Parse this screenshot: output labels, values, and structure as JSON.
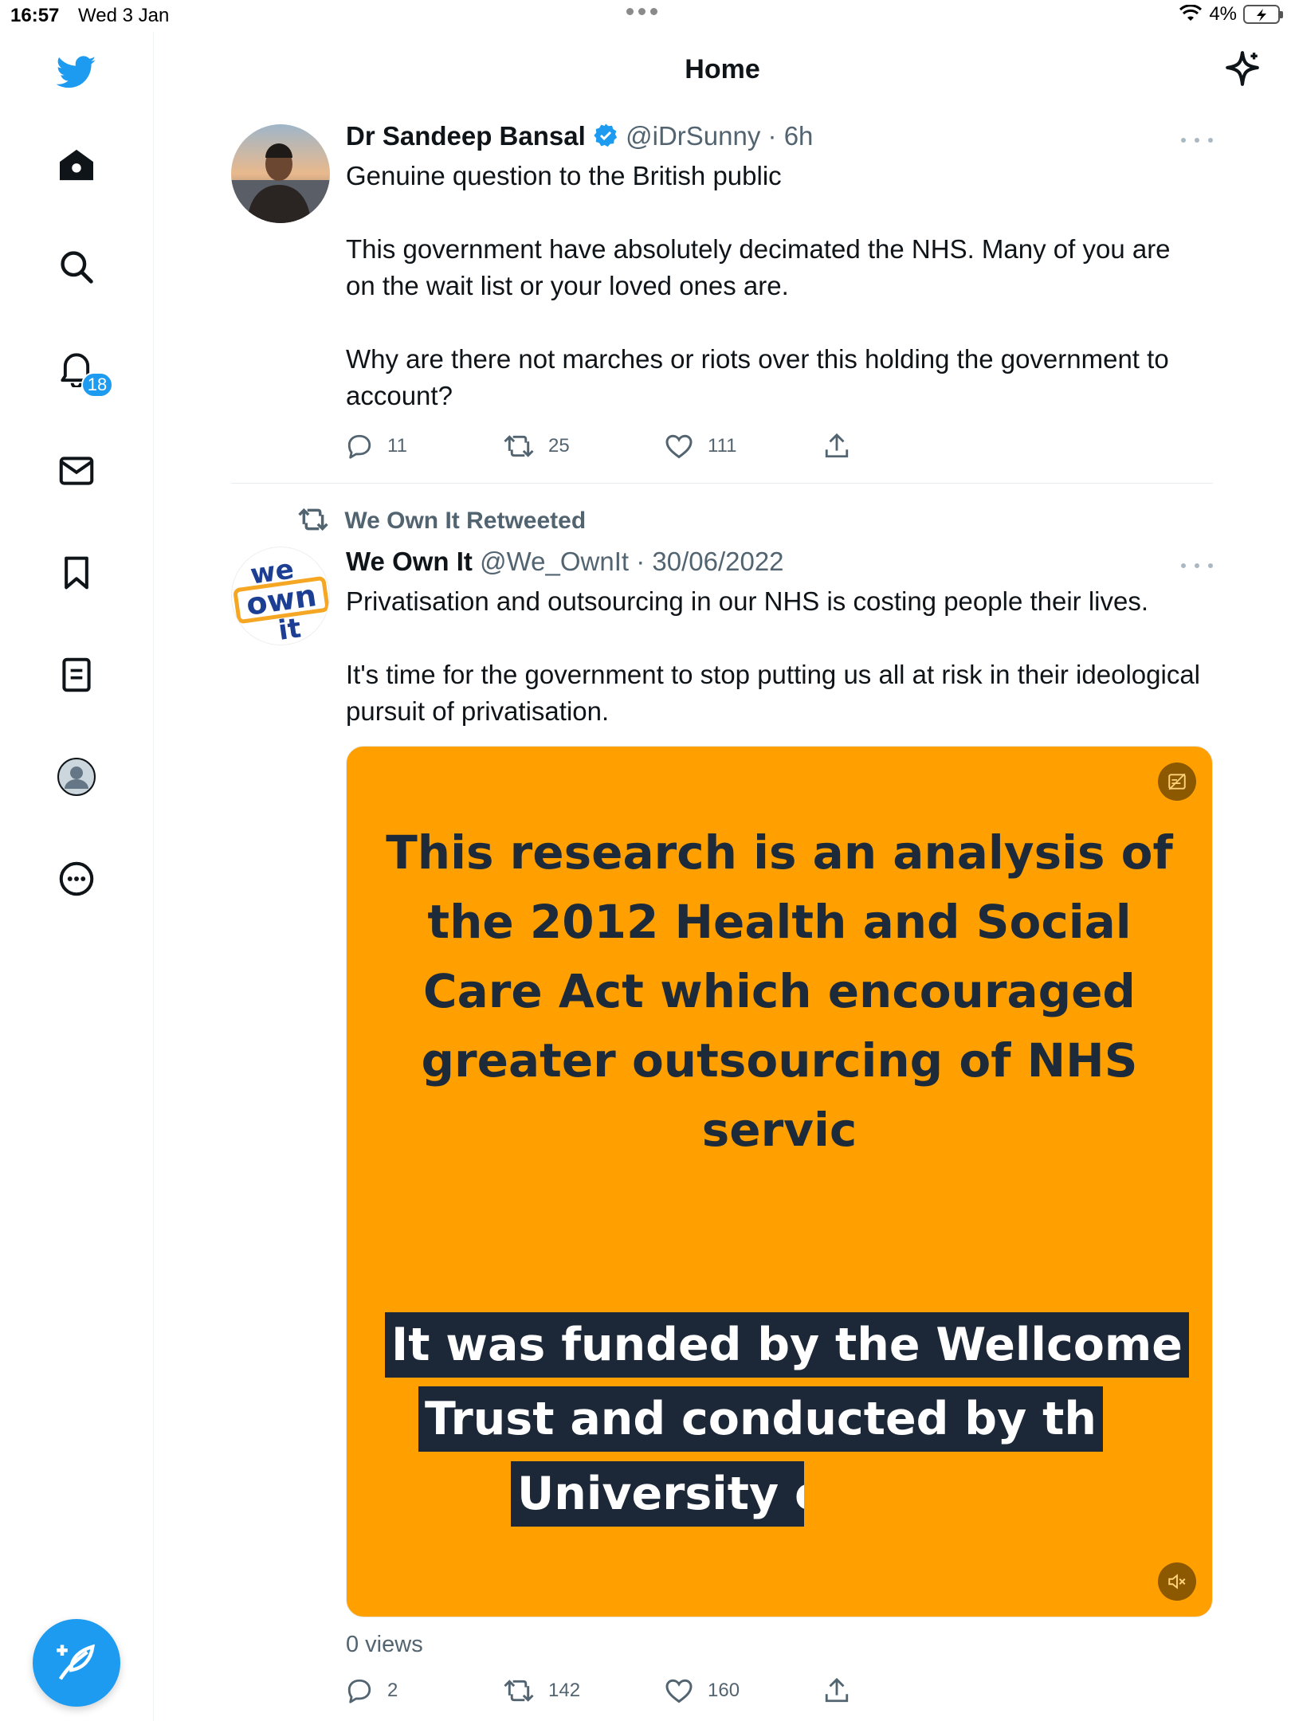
{
  "status_bar": {
    "time": "16:57",
    "date": "Wed 3 Jan",
    "battery": "4%"
  },
  "header": {
    "title": "Home"
  },
  "sidebar": {
    "notifications_badge": "18"
  },
  "tweets": [
    {
      "author_name": "Dr Sandeep Bansal",
      "handle": "@iDrSunny",
      "time": "· 6h",
      "verified": true,
      "text": "Genuine question to the British public\n\nThis government have absolutely decimated the NHS. Many of you are on the wait list or your loved ones are.\n\nWhy are there not marches or riots over this holding the government to account?",
      "replies": "11",
      "retweets": "25",
      "likes": "111"
    },
    {
      "retweeted_by": "We Own It Retweeted",
      "author_name": "We Own It",
      "handle": "@We_OwnIt",
      "time": "· 30/06/2022",
      "avatar_text": [
        "we",
        "own",
        "it"
      ],
      "text": "Privatisation and outsourcing in our NHS is costing people their lives.\n\nIt's time for the government to stop putting us all at risk in their ideological pursuit of privatisation.",
      "media": {
        "background": "#ffa000",
        "headline": "This research is an analysis of the 2012 Health and Social Care Act which encouraged greater outsourcing of NHS servic",
        "caption_lines": [
          "It was funded by the Wellcome",
          "Trust and conducted by th",
          "University of Ox"
        ]
      },
      "views": "0 views",
      "replies": "2",
      "retweets": "142",
      "likes": "160"
    }
  ],
  "colors": {
    "accent": "#1d9bf0",
    "text": "#0f1419",
    "muted": "#536471"
  }
}
